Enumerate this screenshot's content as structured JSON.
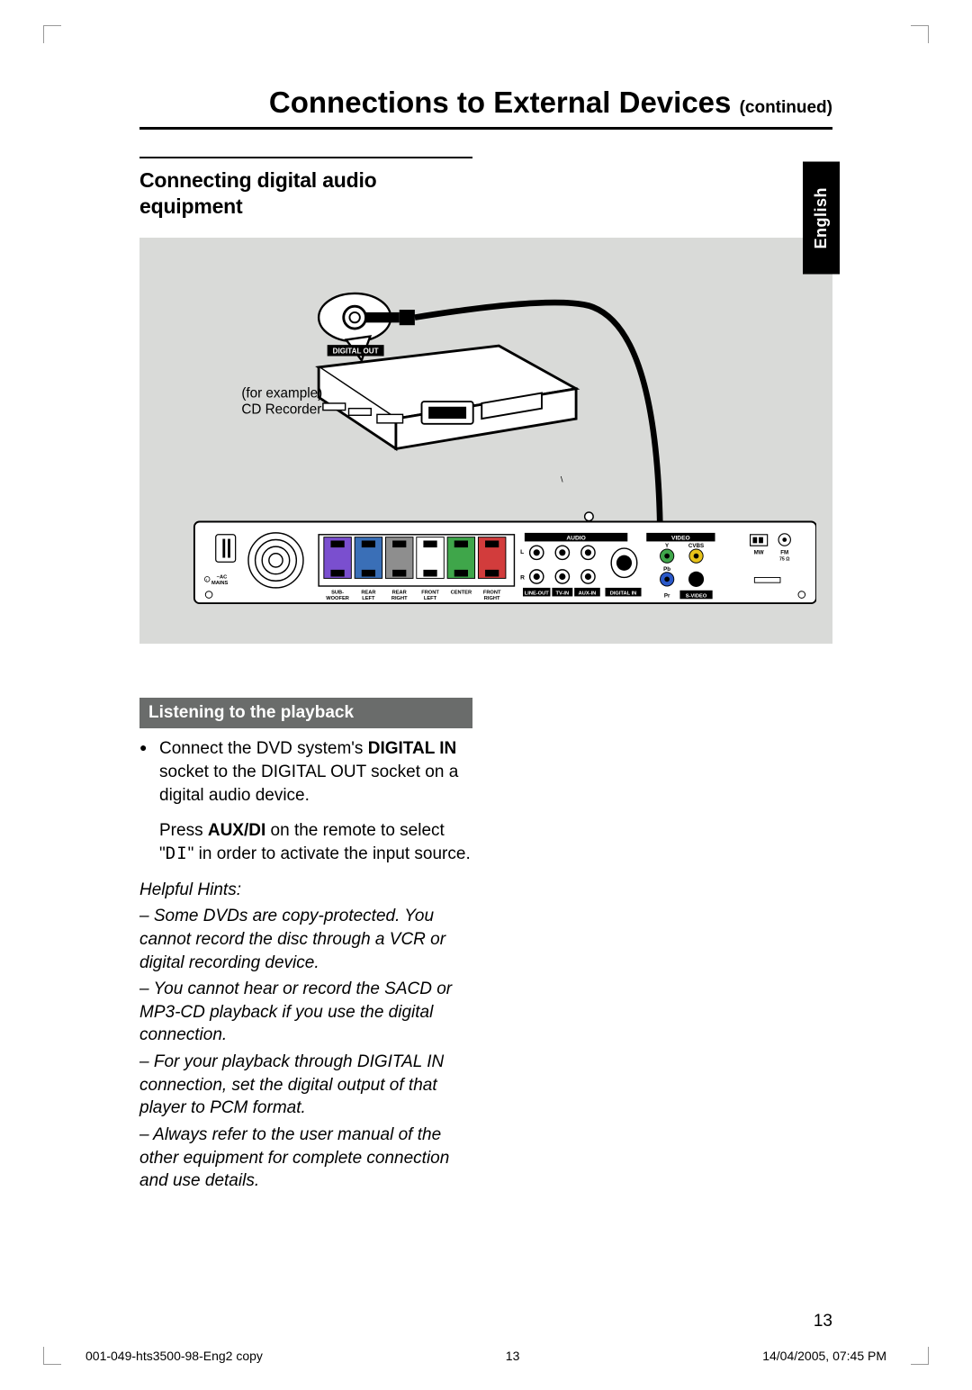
{
  "title": {
    "main": "Connections to External Devices",
    "cont": "(continued)"
  },
  "lang_tab": "English",
  "section_heading": "Connecting digital audio equipment",
  "diagram": {
    "example_label_1": "(for example)",
    "example_label_2": "CD Recorder",
    "digital_out": "DIGITAL OUT",
    "rear_panel": {
      "ac_mains": "~AC\nMAINS",
      "audio_header": "AUDIO",
      "speaker_labels": [
        "SUB-\nWOOFER",
        "REAR\nLEFT",
        "REAR\nRIGHT",
        "FRONT\nLEFT",
        "CENTER",
        "FRONT\nRIGHT"
      ],
      "l": "L",
      "r": "R",
      "line_out": "LINE-OUT",
      "tv_in": "TV-IN",
      "aux_in": "AUX-IN",
      "digital_in": "DIGITAL IN",
      "video_header": "VIDEO",
      "y": "Y",
      "cvbs": "CVBS",
      "pb": "Pb",
      "pr": "Pr",
      "s_video": "S-VIDEO",
      "mw": "MW",
      "fm": "FM\n75 Ω"
    }
  },
  "subhead": "Listening to the playback",
  "para1": {
    "pre": "Connect the DVD system's ",
    "digital_in": "DIGITAL IN",
    "post": " socket to the DIGITAL OUT socket on a digital audio device."
  },
  "para2": {
    "pre": "Press ",
    "aux": "AUX/DI",
    "mid": " on the remote to select \"",
    "di": "DI",
    "post": "\" in order to activate the input source."
  },
  "hints": {
    "title": "Helpful Hints:",
    "h1": "– Some DVDs are copy-protected. You cannot record the disc through a VCR or digital recording device.",
    "h2": "– You cannot hear or record the SACD or MP3-CD playback if you use the digital connection.",
    "h3": "– For your playback through DIGITAL IN connection, set the digital output of that player to PCM format.",
    "h4": "– Always refer to the user manual of the other equipment for complete connection and use details."
  },
  "page_number": "13",
  "footer": {
    "left": "001-049-hts3500-98-Eng2 copy",
    "mid": "13",
    "right": "14/04/2005, 07:45 PM"
  }
}
